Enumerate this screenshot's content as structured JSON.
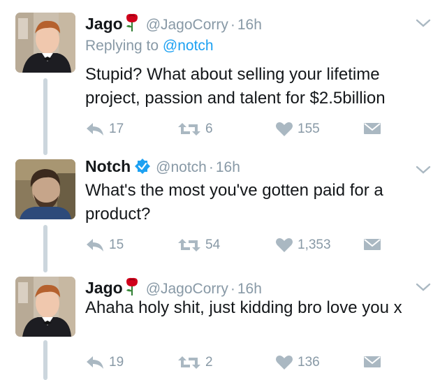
{
  "tweets": [
    {
      "name": "Jago",
      "handle": "@JagoCorry",
      "separator": "·",
      "time": "16h",
      "emoji": "rose-icon",
      "replying_prefix": "Replying to",
      "replying_to": "@notch",
      "text": "Stupid? What about selling your lifetime project, passion and talent for $2.5billion",
      "replies": "17",
      "retweets": "6",
      "likes": "155"
    },
    {
      "name": "Notch",
      "handle": "@notch",
      "separator": "·",
      "time": "16h",
      "verified": true,
      "text": "What's the most you've gotten paid for a product?",
      "replies": "15",
      "retweets": "54",
      "likes": "1,353"
    },
    {
      "name": "Jago",
      "handle": "@JagoCorry",
      "separator": "·",
      "time": "16h",
      "emoji": "rose-icon",
      "text": "Ahaha holy shit, just kidding bro love you x",
      "replies": "19",
      "retweets": "2",
      "likes": "136"
    }
  ],
  "colors": {
    "muted": "#8899a6",
    "link": "#1da1f2",
    "thread_line": "#ccd6dd",
    "rose": "#d0021b"
  }
}
